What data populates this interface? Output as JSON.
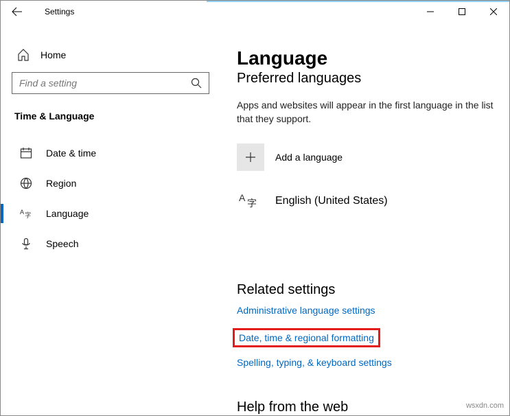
{
  "titlebar": {
    "title": "Settings"
  },
  "sidebar": {
    "home": "Home",
    "search_placeholder": "Find a setting",
    "category": "Time & Language",
    "items": [
      {
        "label": "Date & time"
      },
      {
        "label": "Region"
      },
      {
        "label": "Language"
      },
      {
        "label": "Speech"
      }
    ]
  },
  "main": {
    "heading": "Language",
    "subheading": "Preferred languages",
    "description": "Apps and websites will appear in the first language in the list that they support.",
    "add_label": "Add a language",
    "current_lang": "English (United States)",
    "related_heading": "Related settings",
    "link1": "Administrative language settings",
    "link2": "Date, time & regional formatting",
    "link3": "Spelling, typing, & keyboard settings",
    "help_heading": "Help from the web"
  },
  "watermark": "wsxdn.com"
}
